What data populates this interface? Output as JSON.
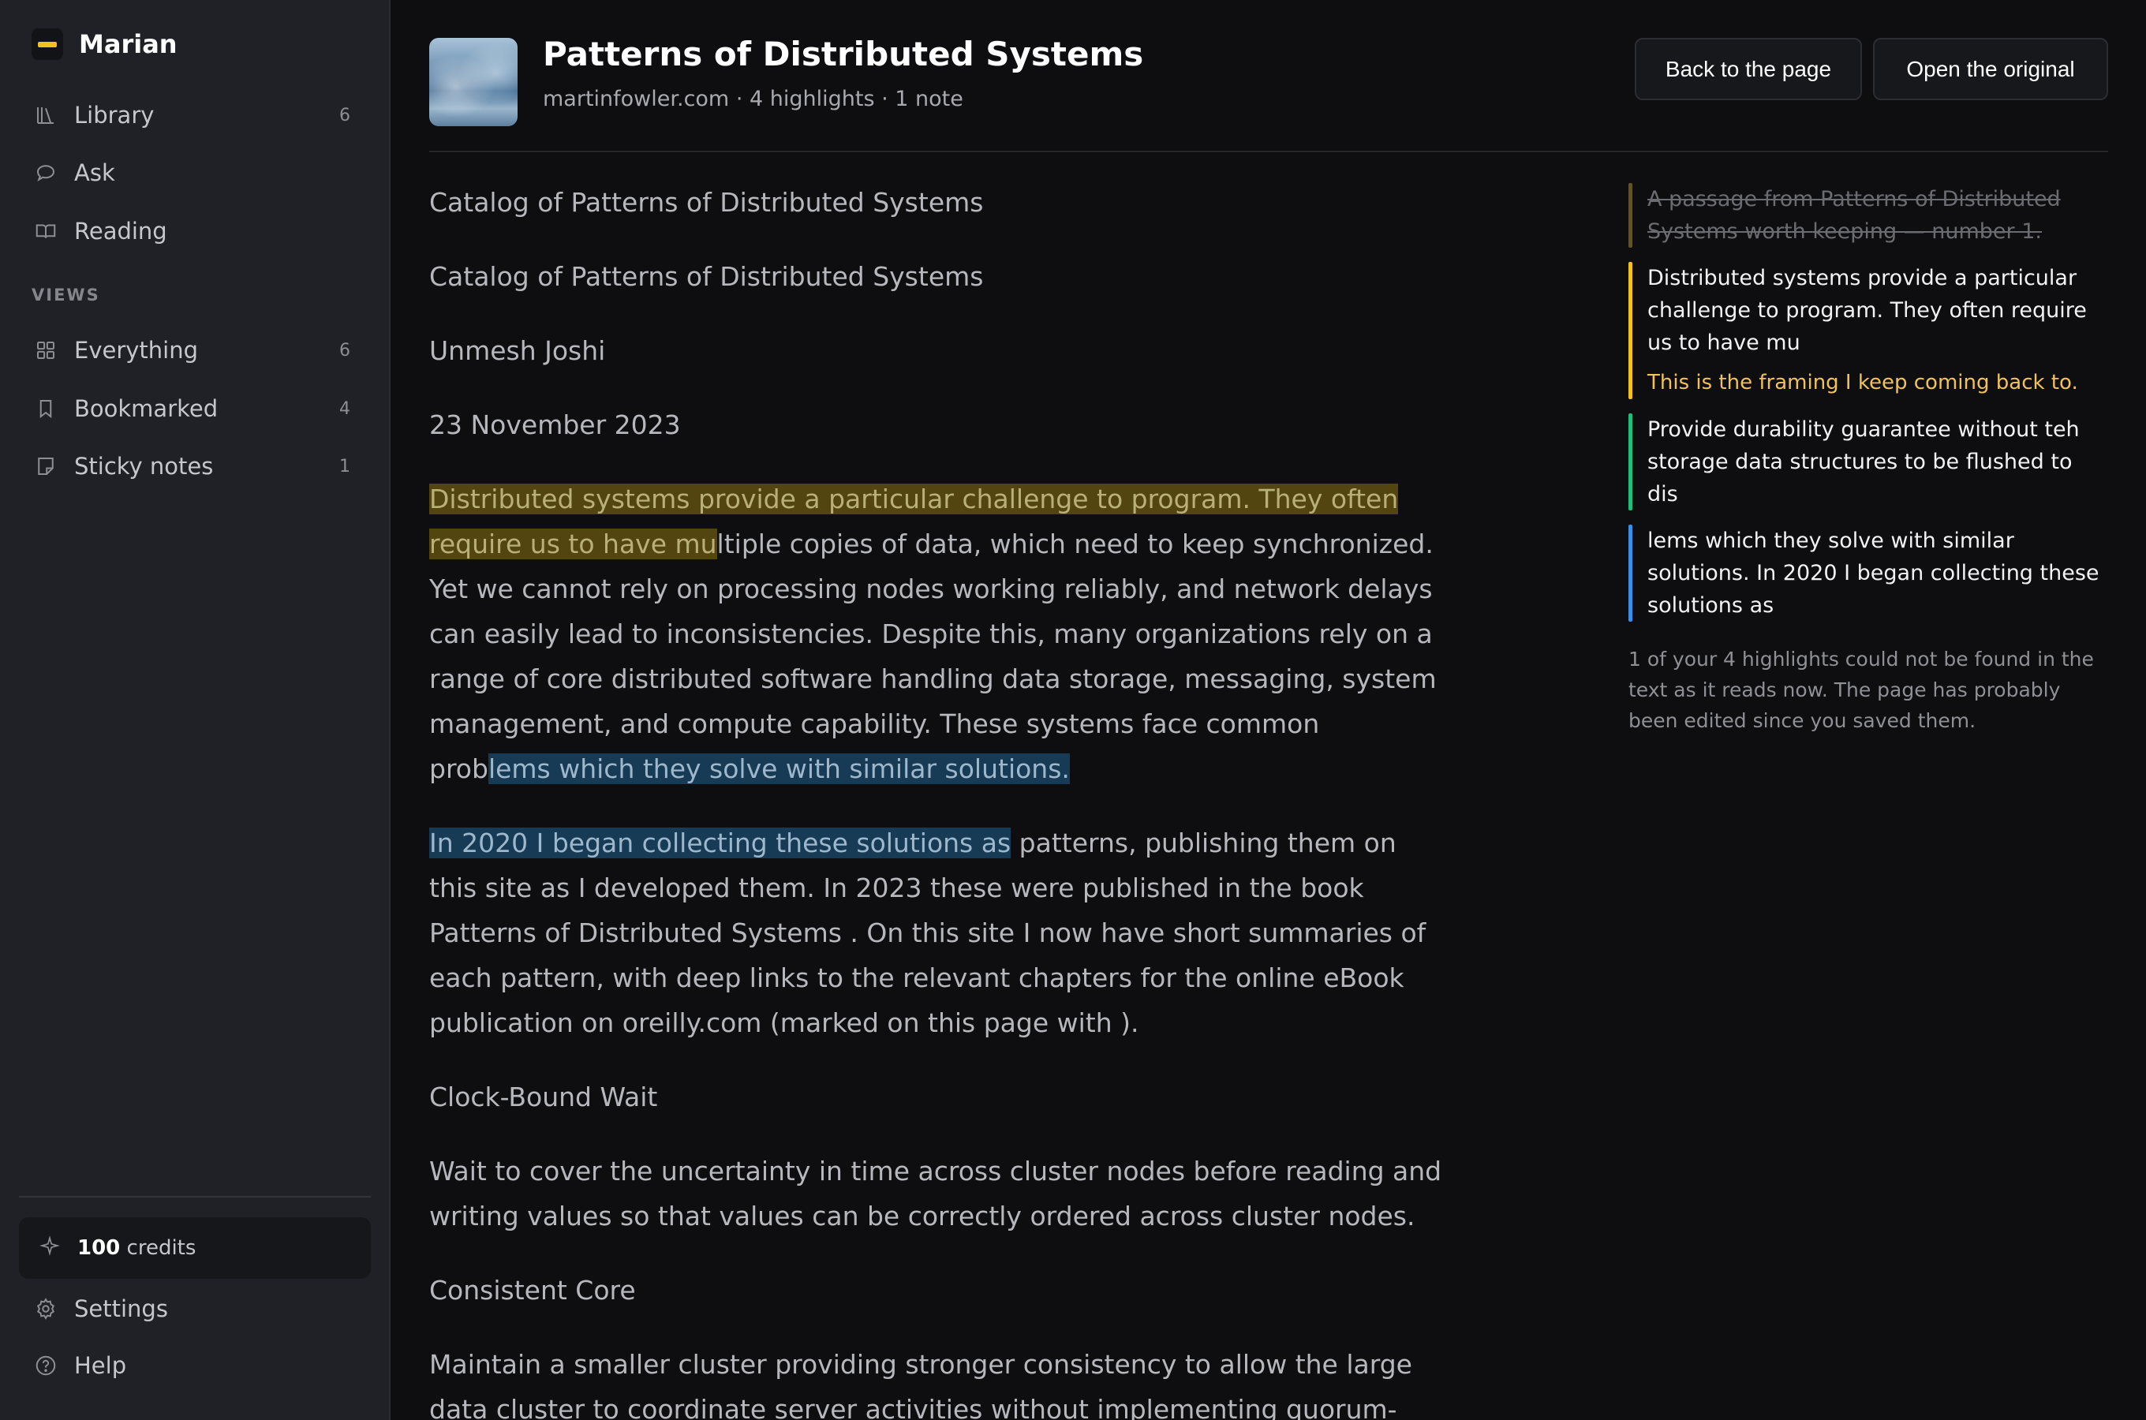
{
  "app": {
    "name": "Marian",
    "accent": "#f2c21b"
  },
  "sidebar": {
    "items": [
      {
        "label": "Library",
        "count": "6",
        "icon": "library-icon"
      },
      {
        "label": "Ask",
        "count": "",
        "icon": "chat-bubble-icon"
      },
      {
        "label": "Reading",
        "count": "",
        "icon": "open-book-icon"
      }
    ],
    "views_label": "VIEWS",
    "views": [
      {
        "label": "Everything",
        "count": "6",
        "icon": "grid-icon"
      },
      {
        "label": "Bookmarked",
        "count": "4",
        "icon": "bookmark-icon"
      },
      {
        "label": "Sticky notes",
        "count": "1",
        "icon": "sticky-note-icon"
      }
    ],
    "credits_amount": "100",
    "credits_label": "credits",
    "settings_label": "Settings",
    "help_label": "Help"
  },
  "header": {
    "title": "Patterns of Distributed Systems",
    "meta": "martinfowler.com · 4 highlights · 1 note",
    "back_label": "Back to the page",
    "open_label": "Open the original"
  },
  "article": {
    "p1": "Catalog of Patterns of Distributed Systems",
    "p2": "Catalog of Patterns of Distributed Systems",
    "p3": "Unmesh Joshi",
    "p4": "23 November 2023",
    "p5_hl1": "Distributed systems provide a particular challenge to program. They often require us to have mu",
    "p5_mid": "ltiple copies of data, which need to keep synchronized. Yet we cannot rely on processing nodes working reliably, and network delays can easily lead to inconsistencies. Despite this, many organizations rely on a range of core distributed software handling data storage, messaging, system management, and compute capability. These systems face common prob",
    "p5_hl2": "lems which they solve with similar solutions.",
    "p6_hl": "In 2020 I began collecting these solutions as",
    "p6_rest": " patterns, publishing them on this site as I developed them. In 2023 these were published in the book Patterns of Distributed Systems . On this site I now have short summaries of each pattern, with deep links to the relevant chapters for the online eBook publication on oreilly.com (marked on this page with ).",
    "p7": "Clock-Bound Wait",
    "p8": "Wait to cover the uncertainty in time across cluster nodes before reading and writing values so that values can be correctly ordered across cluster nodes.",
    "p9": "Consistent Core",
    "p10": "Maintain a smaller cluster providing stronger consistency to allow the large data cluster to coordinate server activities without implementing quorum-based"
  },
  "highlights": {
    "missing": "A passage from Patterns of Distributed Systems worth keeping — number 1.",
    "h1": "Distributed systems provide a particular challenge to program. They often require us to have mu",
    "h1_note": "This is the framing I keep coming back to.",
    "h2": "Provide durability guarantee without teh storage data structures to be flushed to dis",
    "h3": "lems which they solve with similar solutions. In 2020 I began collecting these solutions as",
    "footer": "1 of your 4 highlights could not be found in the text as it reads now. The page has probably been edited since you saved them."
  },
  "colors": {
    "highlight_yellow": "#53450f",
    "highlight_blue": "#173a55",
    "highlight_green": "#1fbf7a",
    "note_text": "#f0c35a"
  }
}
